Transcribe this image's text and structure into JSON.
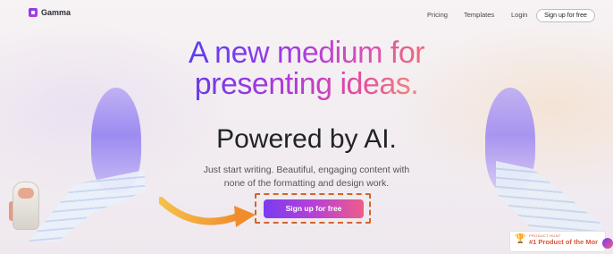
{
  "nav": {
    "logo_text": "Gamma",
    "links": [
      "Pricing",
      "Templates",
      "Login"
    ],
    "cta_label": "Sign up for free"
  },
  "hero": {
    "line1": "A new medium for",
    "line2": "presenting ideas.",
    "powered": "Powered by AI.",
    "sub1": "Just start writing. Beautiful, engaging content with",
    "sub2": "none of the formatting and design work.",
    "cta_label": "Sign up for free"
  },
  "badge": {
    "small": "PRODUCT HUNT",
    "big": "#1 Product of the Mor"
  },
  "colors": {
    "brand": "#7a3cf0",
    "accent_pink": "#ee5c8a",
    "highlight_outline": "#d3642a",
    "arrow": "#f2a43a"
  },
  "icons": [
    "gamma-logo-icon",
    "trophy-icon",
    "chat-icon"
  ]
}
